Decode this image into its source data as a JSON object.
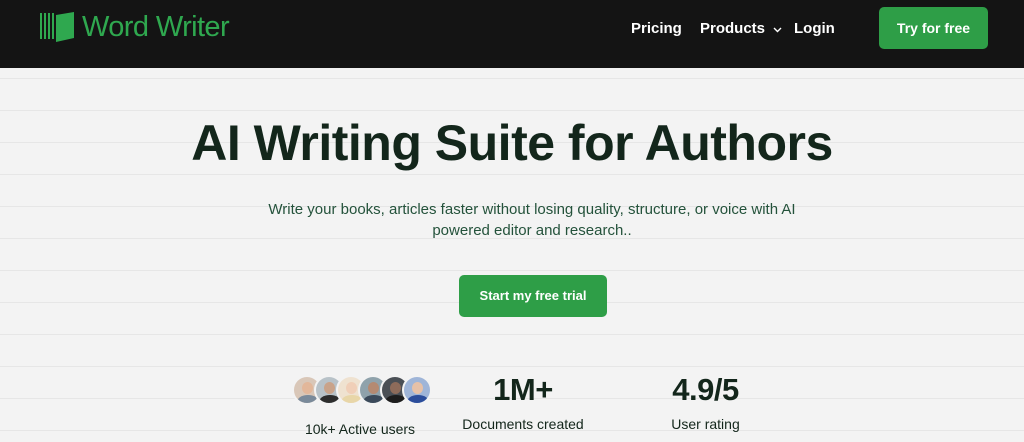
{
  "brand": {
    "name": "Word Writer",
    "color": "#2fa84f"
  },
  "nav": {
    "pricing": "Pricing",
    "products": "Products",
    "login": "Login",
    "cta": "Try for free"
  },
  "hero": {
    "title": "AI Writing Suite for Authors",
    "subtitle": "Write your books, articles faster without losing quality, structure, or voice with AI powered editor and research..",
    "cta": "Start my free trial"
  },
  "stats": {
    "users_label": "10k+ Active users",
    "docs_value": "1M+",
    "docs_label": "Documents created",
    "rating_value": "4.9/5",
    "rating_label": "User rating"
  },
  "avatars": [
    {
      "skin": "#e2b79a",
      "shirt": "#7a8a9a",
      "bg": "#d9c7b8"
    },
    {
      "skin": "#c9a38a",
      "shirt": "#2d2d2d",
      "bg": "#b8c2c8"
    },
    {
      "skin": "#f0cfb8",
      "shirt": "#e8d6a8",
      "bg": "#efe2d0"
    },
    {
      "skin": "#b48a72",
      "shirt": "#3b4a5a",
      "bg": "#8fa2ab"
    },
    {
      "skin": "#8d6b5a",
      "shirt": "#1d1d1d",
      "bg": "#4a4f55"
    },
    {
      "skin": "#e6c1a8",
      "shirt": "#2b4d9b",
      "bg": "#9fb5d8"
    }
  ],
  "colors": {
    "accent": "#2e9e47",
    "nav_bg": "#141414",
    "heading": "#13261b"
  }
}
